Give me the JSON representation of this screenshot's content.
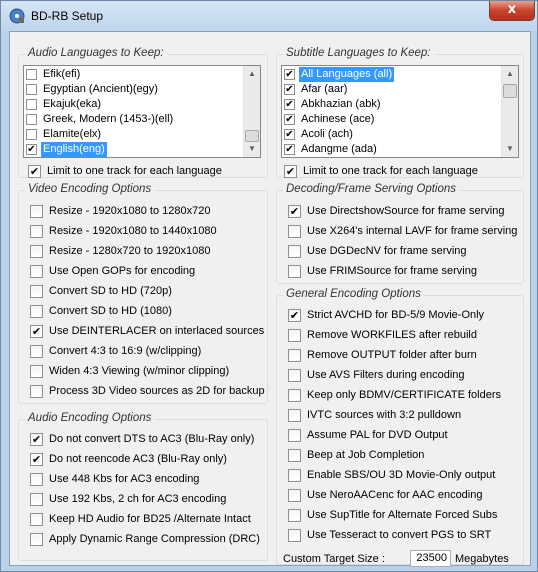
{
  "window": {
    "title": "BD-RB Setup",
    "close_glyph": "x"
  },
  "audio_languages": {
    "title": "Audio Languages to Keep:",
    "items": [
      {
        "label": "Efik(efi)",
        "checked": false,
        "selected": false
      },
      {
        "label": "Egyptian (Ancient)(egy)",
        "checked": false,
        "selected": false
      },
      {
        "label": "Ekajuk(eka)",
        "checked": false,
        "selected": false
      },
      {
        "label": "Greek, Modern (1453-)(ell)",
        "checked": false,
        "selected": false
      },
      {
        "label": "Elamite(elx)",
        "checked": false,
        "selected": false
      },
      {
        "label": "English(eng)",
        "checked": true,
        "selected": true
      }
    ],
    "limit_label": "Limit to one track for each language",
    "limit_checked": true
  },
  "subtitle_languages": {
    "title": "Subtitle Languages to Keep:",
    "items": [
      {
        "label": "All Languages (all)",
        "checked": true,
        "selected": true
      },
      {
        "label": "Afar (aar)",
        "checked": true,
        "selected": false
      },
      {
        "label": "Abkhazian (abk)",
        "checked": true,
        "selected": false
      },
      {
        "label": "Achinese (ace)",
        "checked": true,
        "selected": false
      },
      {
        "label": "Acoli (ach)",
        "checked": true,
        "selected": false
      },
      {
        "label": "Adangme (ada)",
        "checked": true,
        "selected": false
      }
    ],
    "limit_label": "Limit to one track for each language",
    "limit_checked": true
  },
  "video": {
    "title": "Video Encoding Options",
    "options": [
      {
        "label": "Resize  - 1920x1080 to 1280x720",
        "checked": false
      },
      {
        "label": "Resize  - 1920x1080 to 1440x1080",
        "checked": false
      },
      {
        "label": "Resize  - 1280x720 to 1920x1080",
        "checked": false
      },
      {
        "label": "Use Open GOPs for encoding",
        "checked": false
      },
      {
        "label": "Convert SD to HD (720p)",
        "checked": false
      },
      {
        "label": "Convert SD to HD (1080)",
        "checked": false
      },
      {
        "label": "Use DEINTERLACER on interlaced sources",
        "checked": true
      },
      {
        "label": "Convert 4:3 to 16:9 (w/clipping)",
        "checked": false
      },
      {
        "label": "Widen 4:3 Viewing (w/minor clipping)",
        "checked": false
      },
      {
        "label": "Process 3D Video sources as 2D for backup",
        "checked": false
      }
    ]
  },
  "audio": {
    "title": "Audio Encoding Options",
    "options": [
      {
        "label": "Do not convert DTS to AC3  (Blu-Ray only)",
        "checked": true
      },
      {
        "label": "Do not reencode AC3  (Blu-Ray only)",
        "checked": true
      },
      {
        "label": "Use 448 Kbs for AC3 encoding",
        "checked": false
      },
      {
        "label": "Use 192 Kbs, 2 ch for AC3 encoding",
        "checked": false
      },
      {
        "label": "Keep HD Audio for BD25 /Alternate Intact",
        "checked": false
      },
      {
        "label": "Apply Dynamic Range Compression (DRC)",
        "checked": false
      }
    ]
  },
  "decoding": {
    "title": "Decoding/Frame Serving Options",
    "options": [
      {
        "label": "Use DirectshowSource for frame serving",
        "checked": true
      },
      {
        "label": "Use X264's internal LAVF for frame serving",
        "checked": false
      },
      {
        "label": "Use DGDecNV for frame serving",
        "checked": false
      },
      {
        "label": "Use FRIMSource for frame serving",
        "checked": false
      }
    ]
  },
  "general": {
    "title": "General Encoding Options",
    "options": [
      {
        "label": "Strict AVCHD for BD-5/9 Movie-Only",
        "checked": true
      },
      {
        "label": "Remove WORKFILES after rebuild",
        "checked": false
      },
      {
        "label": "Remove OUTPUT folder after burn",
        "checked": false
      },
      {
        "label": "Use AVS Filters during encoding",
        "checked": false
      },
      {
        "label": "Keep only BDMV/CERTIFICATE folders",
        "checked": false
      },
      {
        "label": "IVTC sources with 3:2 pulldown",
        "checked": false
      },
      {
        "label": "Assume PAL for DVD Output",
        "checked": false
      },
      {
        "label": "Beep at Job Completion",
        "checked": false
      },
      {
        "label": "Enable SBS/OU 3D Movie-Only output",
        "checked": false
      },
      {
        "label": "Use NeroAACenc for AAC encoding",
        "checked": false
      },
      {
        "label": "Use SupTitle for Alternate Forced Subs",
        "checked": false
      },
      {
        "label": "Use Tesseract to convert PGS to SRT",
        "checked": false
      }
    ],
    "custom_size_label": "Custom Target Size :",
    "custom_size_value": "23500",
    "custom_size_unit": "Megabytes"
  },
  "check_glyph": "✔"
}
